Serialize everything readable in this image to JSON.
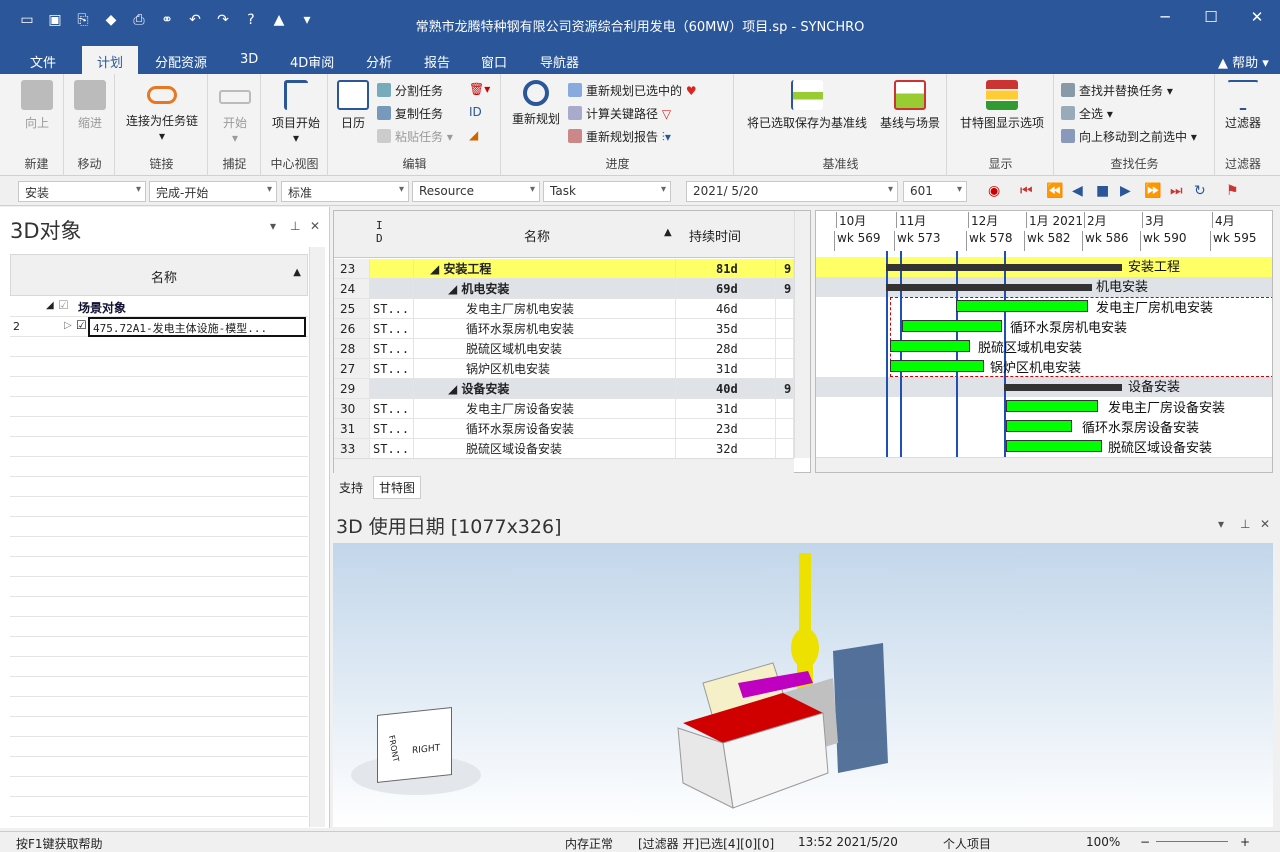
{
  "window": {
    "title": "常熟市龙腾特种钢有限公司资源综合利用发电（60MW）项目.sp - SYNCHRO",
    "help": "帮助"
  },
  "menu": {
    "tabs": [
      "文件",
      "计划",
      "分配资源",
      "3D",
      "4D审阅",
      "分析",
      "报告",
      "窗口",
      "导航器"
    ]
  },
  "ribbon": {
    "new": {
      "up": "向上",
      "group": "新建"
    },
    "move": {
      "indent": "缩进",
      "group": "移动"
    },
    "link": {
      "label": "连接为任务链",
      "group": "链接"
    },
    "capture": {
      "label": "开始",
      "group": "捕捉"
    },
    "center": {
      "label": "项目开始",
      "group": "中心视图"
    },
    "edit": {
      "calendar": "日历",
      "split": "分割任务",
      "copy": "复制任务",
      "paste": "粘贴任务",
      "group": "编辑"
    },
    "progress": {
      "reschedule": "重新规划",
      "selected": "重新规划已选中的",
      "critical": "计算关键路径",
      "report": "重新规划报告",
      "group": "进度"
    },
    "baseline": {
      "save": "将已选取保存为基准线",
      "scene": "基线与场景",
      "group": "基准线"
    },
    "display": {
      "gantt": "甘特图显示选项",
      "group": "显示"
    },
    "find": {
      "replace": "查找并替换任务",
      "all": "全选",
      "moveup": "向上移动到之前选中",
      "group": "查找任务"
    },
    "filter": {
      "label": "过滤器",
      "group": "过滤器"
    }
  },
  "toolbar": {
    "combo1": "安装",
    "combo2": "完成-开始",
    "combo3": "标准",
    "combo4": "Resource",
    "combo5": "Task",
    "date": "2021/  5/20",
    "num": "601"
  },
  "left": {
    "title": "3D对象",
    "col": "名称",
    "root": "场景对象",
    "rownum": "2",
    "child": "475.72A1-发电主体设施-模型..."
  },
  "grid": {
    "h_id": "I D",
    "h_name": "名称",
    "h_dur": "持续时间",
    "rows": [
      {
        "id": "23",
        "type": "",
        "name": "安装工程",
        "dur": "81d",
        "extra": "9",
        "level": 0
      },
      {
        "id": "24",
        "type": "",
        "name": "机电安装",
        "dur": "69d",
        "extra": "9",
        "level": 1
      },
      {
        "id": "25",
        "type": "ST...",
        "name": "发电主厂房机电安装",
        "dur": "46d",
        "extra": "",
        "level": 2
      },
      {
        "id": "26",
        "type": "ST...",
        "name": "循环水泵房机电安装",
        "dur": "35d",
        "extra": "",
        "level": 2
      },
      {
        "id": "28",
        "type": "ST...",
        "name": "脱硫区域机电安装",
        "dur": "28d",
        "extra": "",
        "level": 2
      },
      {
        "id": "27",
        "type": "ST...",
        "name": "锅炉区机电安装",
        "dur": "31d",
        "extra": "",
        "level": 2
      },
      {
        "id": "29",
        "type": "",
        "name": "设备安装",
        "dur": "40d",
        "extra": "9",
        "level": 1
      },
      {
        "id": "30",
        "type": "ST...",
        "name": "发电主厂房设备安装",
        "dur": "31d",
        "extra": "",
        "level": 2
      },
      {
        "id": "31",
        "type": "ST...",
        "name": "循环水泵房设备安装",
        "dur": "23d",
        "extra": "",
        "level": 2
      },
      {
        "id": "33",
        "type": "ST...",
        "name": "脱硫区域设备安装",
        "dur": "32d",
        "extra": "",
        "level": 2
      }
    ]
  },
  "gantt": {
    "months": [
      "10月",
      "11月",
      "12月",
      "1月 2021",
      "2月",
      "3月",
      "4月"
    ],
    "weeks": [
      "wk 569",
      "wk 573",
      "wk 578",
      "wk 582",
      "wk 586",
      "wk 590",
      "wk 595"
    ],
    "labels": [
      "安装工程",
      "机电安装",
      "发电主厂房机电安装",
      "循环水泵房机电安装",
      "脱硫区域机电安装",
      "锅炉区机电安装",
      "设备安装",
      "发电主厂房设备安装",
      "循环水泵房设备安装",
      "脱硫区域设备安装"
    ]
  },
  "tabs": [
    "支持",
    "甘特图"
  ],
  "viewport": {
    "title": "3D 使用日期  [1077x326]",
    "cube_front": "FRONT",
    "cube_right": "RIGHT"
  },
  "status": {
    "help": "按F1键获取帮助",
    "memory": "内存正常",
    "filter": "[过滤器 开]已选[4][0][0]",
    "time": "13:52 2021/5/20",
    "project": "个人项目",
    "zoom": "100%"
  }
}
